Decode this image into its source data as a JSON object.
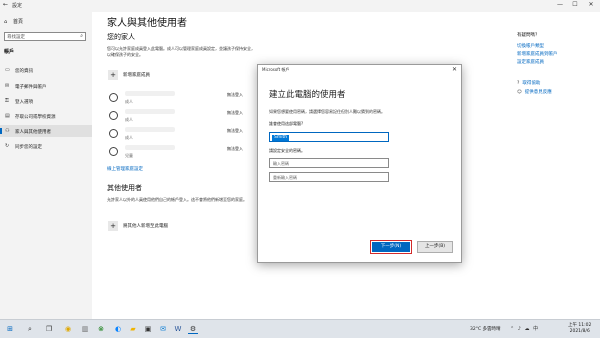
{
  "window": {
    "title": "設定",
    "controls": [
      "—",
      "☐",
      "✕"
    ]
  },
  "sidebar": {
    "home": "首頁",
    "search_placeholder": "尋找設定",
    "section": "帳戶",
    "items": [
      {
        "label": "您的資訊",
        "icon": "person-card-icon"
      },
      {
        "label": "電子郵件與帳戶",
        "icon": "mail-icon"
      },
      {
        "label": "登入選項",
        "icon": "key-icon"
      },
      {
        "label": "存取公司或學校資源",
        "icon": "briefcase-icon"
      },
      {
        "label": "家人與其他使用者",
        "icon": "people-icon"
      },
      {
        "label": "同步您的設定",
        "icon": "sync-icon"
      }
    ]
  },
  "main": {
    "title": "家人與其他使用者",
    "family_title": "您的家人",
    "family_desc": "您可以允許家庭成員登入此電腦。成人可以管理家庭成員設定，並讓孩子保持安全，以確保孩子的安全。",
    "add_family": "新增家庭成員",
    "members": [
      {
        "role": "成人",
        "tag": "無法登入"
      },
      {
        "role": "成人",
        "tag": "無法登入"
      },
      {
        "role": "成人",
        "tag": "無法登入"
      },
      {
        "role": "兒童",
        "tag": "無法登入"
      }
    ],
    "manage_link": "線上管理家庭設定",
    "other_title": "其他使用者",
    "other_desc": "允許家人以外的人員使用他們自己的帳戶登入。這不會將他們新增至您的家庭。",
    "add_other": "將其他人新增至此電腦"
  },
  "rail": {
    "title": "有疑問嗎？",
    "links": [
      "切換帳戶類型",
      "新增家庭成員到帳戶",
      "設定家庭成員"
    ],
    "help": [
      "取得協助",
      "提供意見反應"
    ]
  },
  "dialog": {
    "caption": "Microsoft 帳戶",
    "heading": "建立此電腦的使用者",
    "desc": "如果您想要使用密碼，請選擇您容易記住但別人難以猜到的密碼。",
    "username_label": "誰會使用這部電腦?",
    "username_value": "Smith",
    "password_label": "請設定安全的密碼。",
    "password_placeholder": "輸入密碼",
    "confirm_placeholder": "重新輸入密碼",
    "next": "下一步(N)",
    "back": "上一步(B)"
  },
  "taskbar": {
    "weather": "32°C 多雲時晴",
    "time": "上午 11:02",
    "date": "2021/8/6",
    "sys_icons": "⌃ ♪ ☁ 中"
  }
}
